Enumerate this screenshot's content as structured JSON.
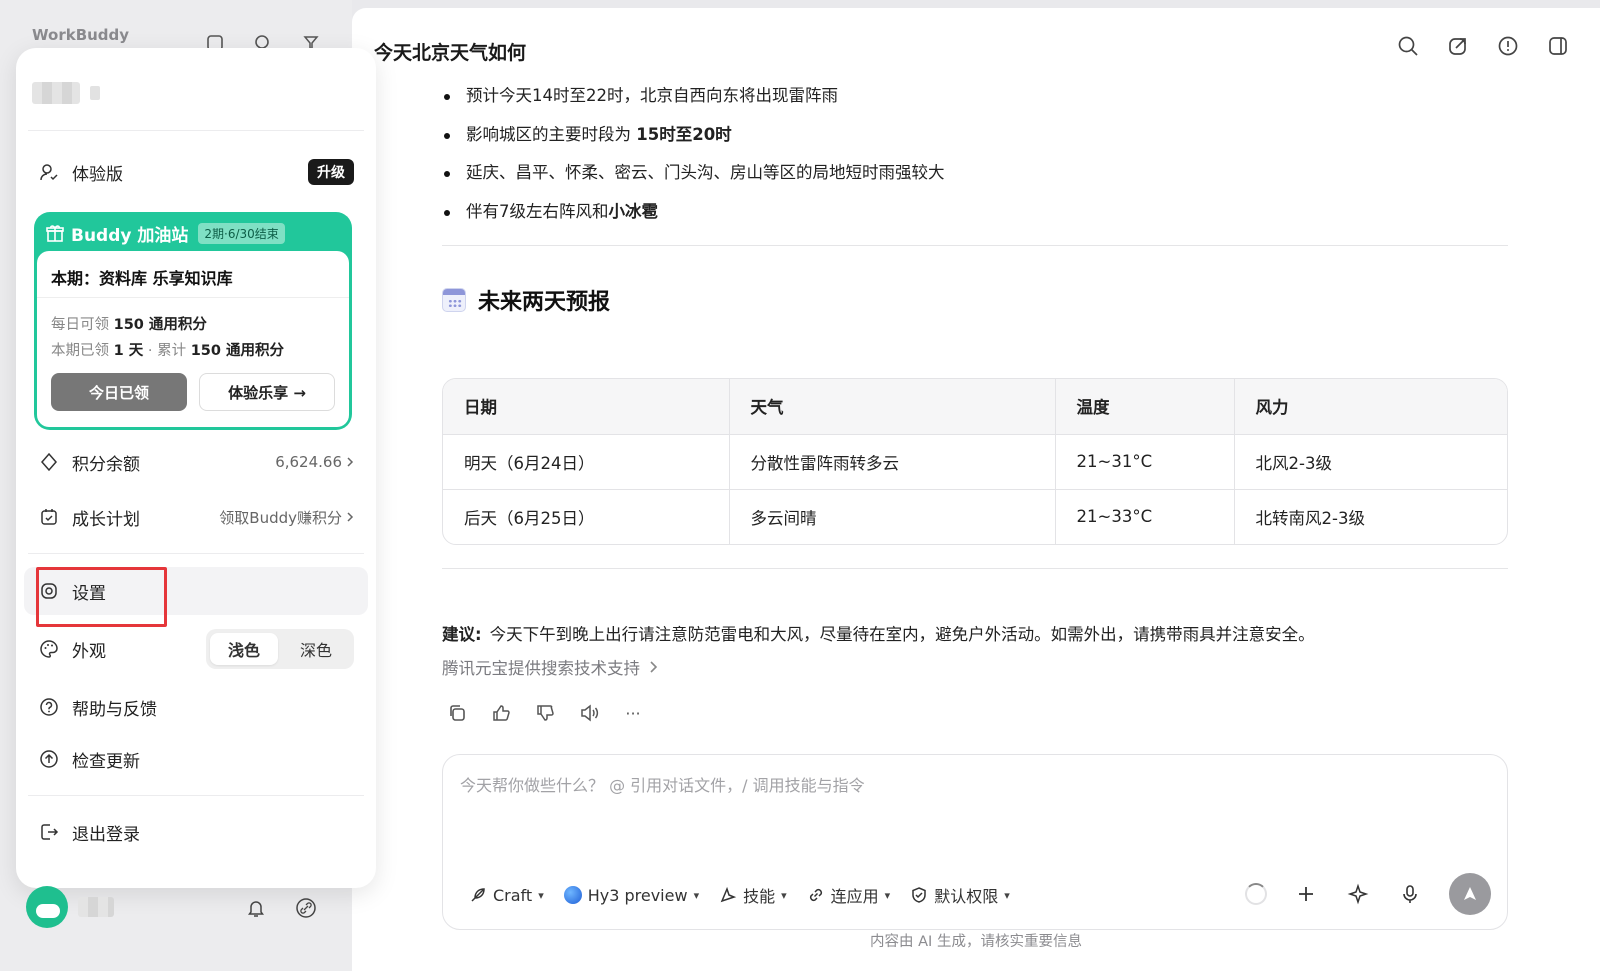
{
  "app": {
    "name": "WorkBuddy"
  },
  "conversation": {
    "title": "今天北京天气如何",
    "bullets": [
      {
        "text": "预计今天14时至22时，北京自西向东将出现雷阵雨",
        "bold": ""
      },
      {
        "text": "影响城区的主要时段为 ",
        "bold": "15时至20时"
      },
      {
        "text": "延庆、昌平、怀柔、密云、门头沟、房山等区的局地短时雨强较大",
        "bold": ""
      },
      {
        "text": "伴有7级左右阵风和",
        "bold": "小冰雹"
      }
    ],
    "section_title": "未来两天预报",
    "table": {
      "headers": [
        "日期",
        "天气",
        "温度",
        "风力"
      ],
      "rows": [
        [
          "明天（6月24日）",
          "分散性雷阵雨转多云",
          "21~31°C",
          "北风2-3级"
        ],
        [
          "后天（6月25日）",
          "多云间晴",
          "21~33°C",
          "北转南风2-3级"
        ]
      ]
    },
    "advice_label": "建议:",
    "advice_text": "今天下午到晚上出行请注意防范雷电和大风，尽量待在室内，避免户外活动。如需外出，请携带雨具并注意安全。",
    "source": "腾讯元宝提供搜索技术支持",
    "more_glyph": "···"
  },
  "composer": {
    "placeholder": "今天帮你做些什么？ @ 引用对话文件，/ 调用技能与指令",
    "mode": "Craft",
    "model": "Hy3 preview",
    "skills": "技能",
    "apps": "连应用",
    "permission": "默认权限"
  },
  "footnote": "内容由 AI 生成，请核实重要信息",
  "menu": {
    "plan": "体验版",
    "upgrade": "升级",
    "promo": {
      "title": "Buddy 加油站",
      "tag": "2期·6/30结束",
      "period": "本期：资料库 乐享知识库",
      "daily_label": "每日可领",
      "daily_value": "150 通用积分",
      "claimed_label": "本期已领",
      "claimed_days": "1 天",
      "sep": "·",
      "total_label": "累计",
      "total_value": "150 通用积分",
      "claimed_button": "今日已领",
      "try_button": "体验乐享 →"
    },
    "points_label": "积分余额",
    "points_value": "6,624.66",
    "growth_label": "成长计划",
    "growth_value": "领取Buddy赚积分",
    "settings": "设置",
    "appearance": "外观",
    "theme_light": "浅色",
    "theme_dark": "深色",
    "help": "帮助与反馈",
    "update": "检查更新",
    "logout": "退出登录"
  },
  "colors": {
    "accent_green": "#21c79b",
    "highlight_red": "#e5363a"
  }
}
